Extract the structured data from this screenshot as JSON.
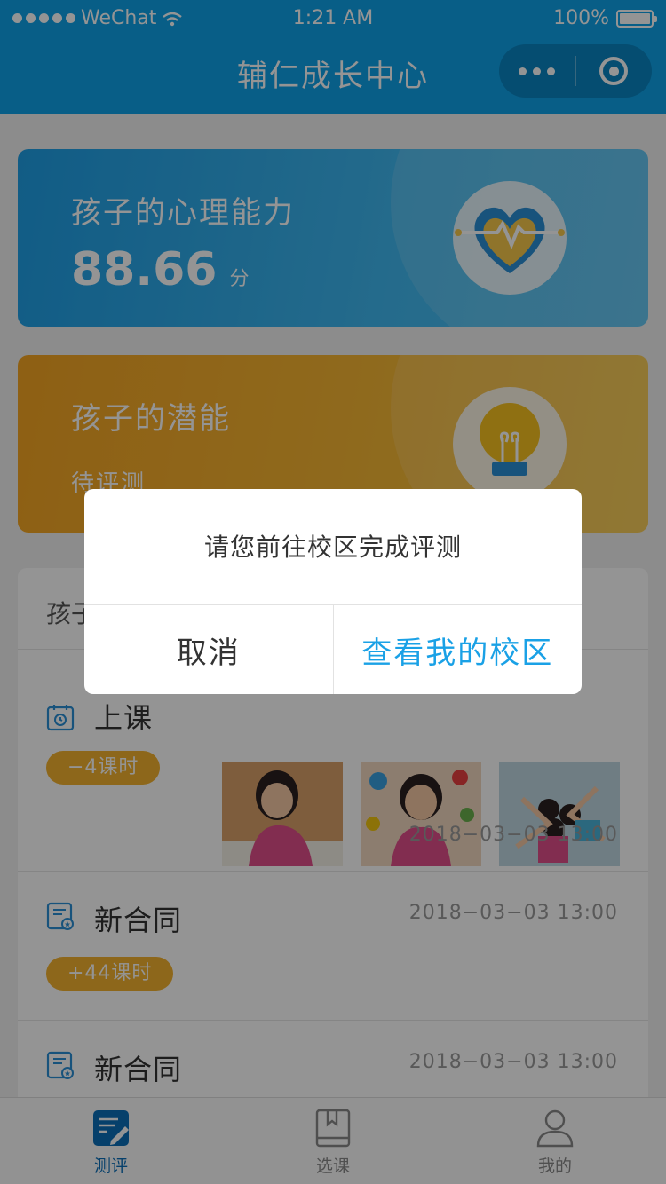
{
  "status_bar": {
    "carrier": "WeChat",
    "time": "1:21 AM",
    "battery": "100%"
  },
  "nav": {
    "title": "辅仁成长中心"
  },
  "cards": {
    "psych": {
      "title": "孩子的心理能力",
      "score": "88.66",
      "unit": "分"
    },
    "potential": {
      "title": "孩子的潜能",
      "status": "待评测"
    }
  },
  "list": {
    "header": "孩子",
    "items": [
      {
        "name": "上课",
        "badge": "−4课时",
        "date": "2018−03−03  13:00"
      },
      {
        "name": "新合同",
        "badge": "+44课时",
        "date": "2018−03−03  13:00"
      },
      {
        "name": "新合同",
        "date": "2018−03−03  13:00"
      }
    ]
  },
  "tabs": [
    {
      "label": "测评",
      "icon": "edit-note-icon",
      "active": true
    },
    {
      "label": "选课",
      "icon": "book-icon",
      "active": false
    },
    {
      "label": "我的",
      "icon": "user-icon",
      "active": false
    }
  ],
  "dialog": {
    "message": "请您前往校区完成评测",
    "cancel": "取消",
    "confirm": "查看我的校区"
  },
  "colors": {
    "primary": "#0fa2e9",
    "accent_orange": "#f3b22f",
    "active_tab": "#0c6fb9"
  }
}
